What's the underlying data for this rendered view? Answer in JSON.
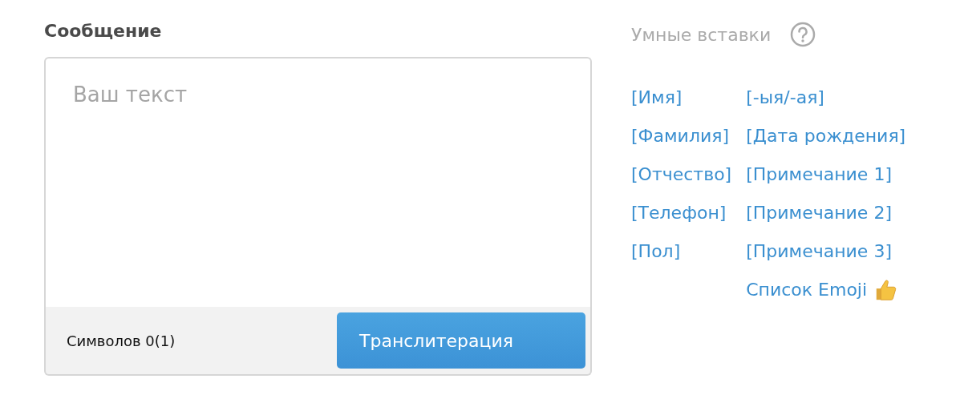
{
  "message": {
    "label": "Сообщение",
    "placeholder": "Ваш текст",
    "counter": "Символов 0(1)",
    "button": "Транслитерация"
  },
  "smart_inserts": {
    "title": "Умные вставки",
    "columns": [
      [
        {
          "kind": "insert",
          "label": "[Имя]"
        },
        {
          "kind": "insert",
          "label": "[Фамилия]"
        },
        {
          "kind": "insert",
          "label": "[Отчество]"
        },
        {
          "kind": "insert",
          "label": "[Телефон]"
        },
        {
          "kind": "insert",
          "label": "[Пол]"
        }
      ],
      [
        {
          "kind": "insert",
          "label": "[-ыя/-ая]"
        },
        {
          "kind": "insert",
          "label": "[Дата рождения]"
        },
        {
          "kind": "insert",
          "label": "[Примечание 1]"
        },
        {
          "kind": "insert",
          "label": "[Примечание 2]"
        },
        {
          "kind": "insert",
          "label": "[Примечание 3]"
        },
        {
          "kind": "emoji",
          "label": "Список Emoji"
        }
      ]
    ]
  }
}
